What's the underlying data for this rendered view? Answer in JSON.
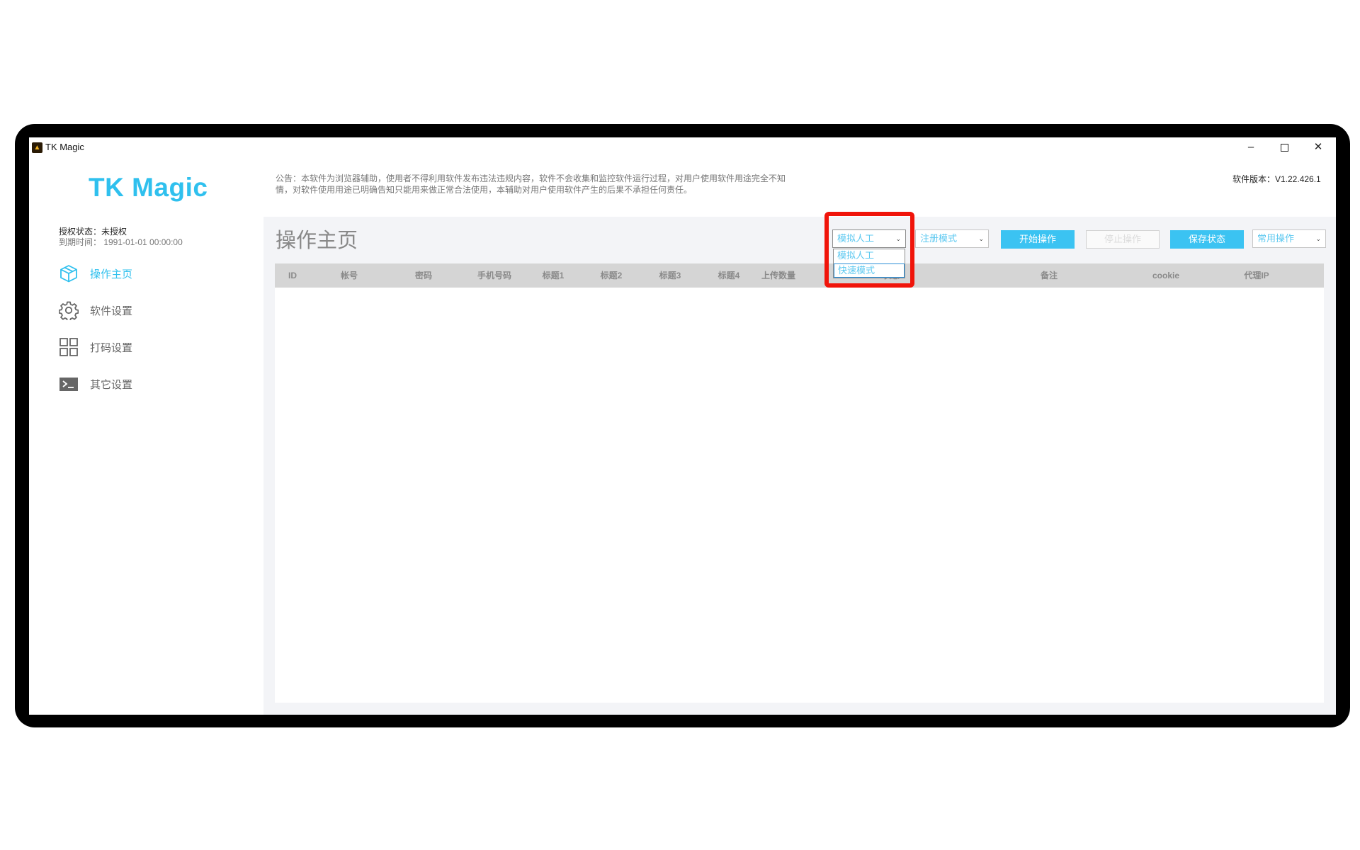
{
  "window": {
    "title": "TK Magic",
    "controls": {
      "minimize": "–",
      "close": "✕"
    }
  },
  "sidebar": {
    "brand": "TK Magic",
    "auth_status": "授权状态：未授权",
    "expire": "到期时间：  1991-01-01 00:00:00",
    "items": [
      {
        "label": "操作主页",
        "icon": "cube-icon",
        "active": true
      },
      {
        "label": "软件设置",
        "icon": "gear-icon",
        "active": false
      },
      {
        "label": "打码设置",
        "icon": "grid-icon",
        "active": false
      },
      {
        "label": "其它设置",
        "icon": "terminal-icon",
        "active": false
      }
    ]
  },
  "header": {
    "notice": "公告：本软件为浏览器辅助，使用者不得利用软件发布违法违规内容，软件不会收集和监控软件运行过程，对用户使用软件用途完全不知情，对软件使用用途已明确告知只能用来做正常合法使用，本辅助对用户使用软件产生的后果不承担任何责任。",
    "version": "软件版本：V1.22.426.1"
  },
  "main": {
    "page_title": "操作主页",
    "mode_select": {
      "value": "模拟人工",
      "options": [
        "模拟人工",
        "快速模式"
      ],
      "highlighted": "快速模式"
    },
    "register_select": {
      "value": "注册模式"
    },
    "common_select": {
      "value": "常用操作"
    },
    "buttons": {
      "start": "开始操作",
      "stop": "停止操作",
      "save": "保存状态"
    },
    "table": {
      "columns": [
        "ID",
        "帐号",
        "密码",
        "手机号码",
        "标题1",
        "标题2",
        "标题3",
        "标题4",
        "上传数量",
        "状态",
        "备注",
        "cookie",
        "代理IP"
      ],
      "rows": []
    }
  },
  "colors": {
    "accent": "#3bc3f2",
    "highlight": "#f0140a",
    "panel": "#f3f4f7"
  }
}
